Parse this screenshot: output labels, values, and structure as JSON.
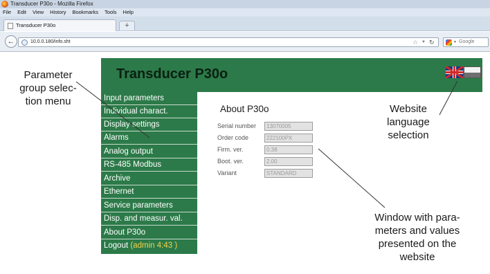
{
  "browser": {
    "window_title": "Transducer P30o - Mozilla Firefox",
    "menu": [
      "File",
      "Edit",
      "View",
      "History",
      "Bookmarks",
      "Tools",
      "Help"
    ],
    "tab_label": "Transducer P30o",
    "new_tab_label": "+",
    "url": "10.0.0.180/info.sht",
    "search_placeholder": "Google",
    "icons": [
      "firefox-logo",
      "back-arrow-icon",
      "globe-icon",
      "star-icon",
      "reload-icon",
      "google-icon"
    ]
  },
  "site": {
    "title": "Transducer P30o",
    "languages": [
      "english-flag",
      "polish-flag"
    ],
    "colors": {
      "header_green": "#2c7a49",
      "session_yellow": "#f3d14b"
    }
  },
  "menu": {
    "items": [
      "Input parameters",
      "Individual charact.",
      "Display settings",
      "Alarms",
      "Analog output",
      "RS-485 Modbus",
      "Archive",
      "Ethernet",
      "Service parameters",
      "Disp. and measur. val.",
      "About P30o"
    ],
    "logout_label": "Logout",
    "session": "(admin 4:43 )"
  },
  "content": {
    "title": "About P30o",
    "fields": [
      {
        "label": "Serial number",
        "value": "13070005"
      },
      {
        "label": "Order code",
        "value": "222100PX"
      },
      {
        "label": "Firm. ver.",
        "value": "0.38"
      },
      {
        "label": "Boot. ver.",
        "value": "2.00"
      },
      {
        "label": "Variant",
        "value": "STANDARD"
      }
    ]
  },
  "annotations": {
    "menu_callout": [
      "Parameter",
      "group selec-",
      "tion menu"
    ],
    "language_callout": [
      "Website",
      "language",
      "selection"
    ],
    "window_callout": [
      "Window with para-",
      "meters and values",
      "presented on the",
      "website"
    ]
  }
}
